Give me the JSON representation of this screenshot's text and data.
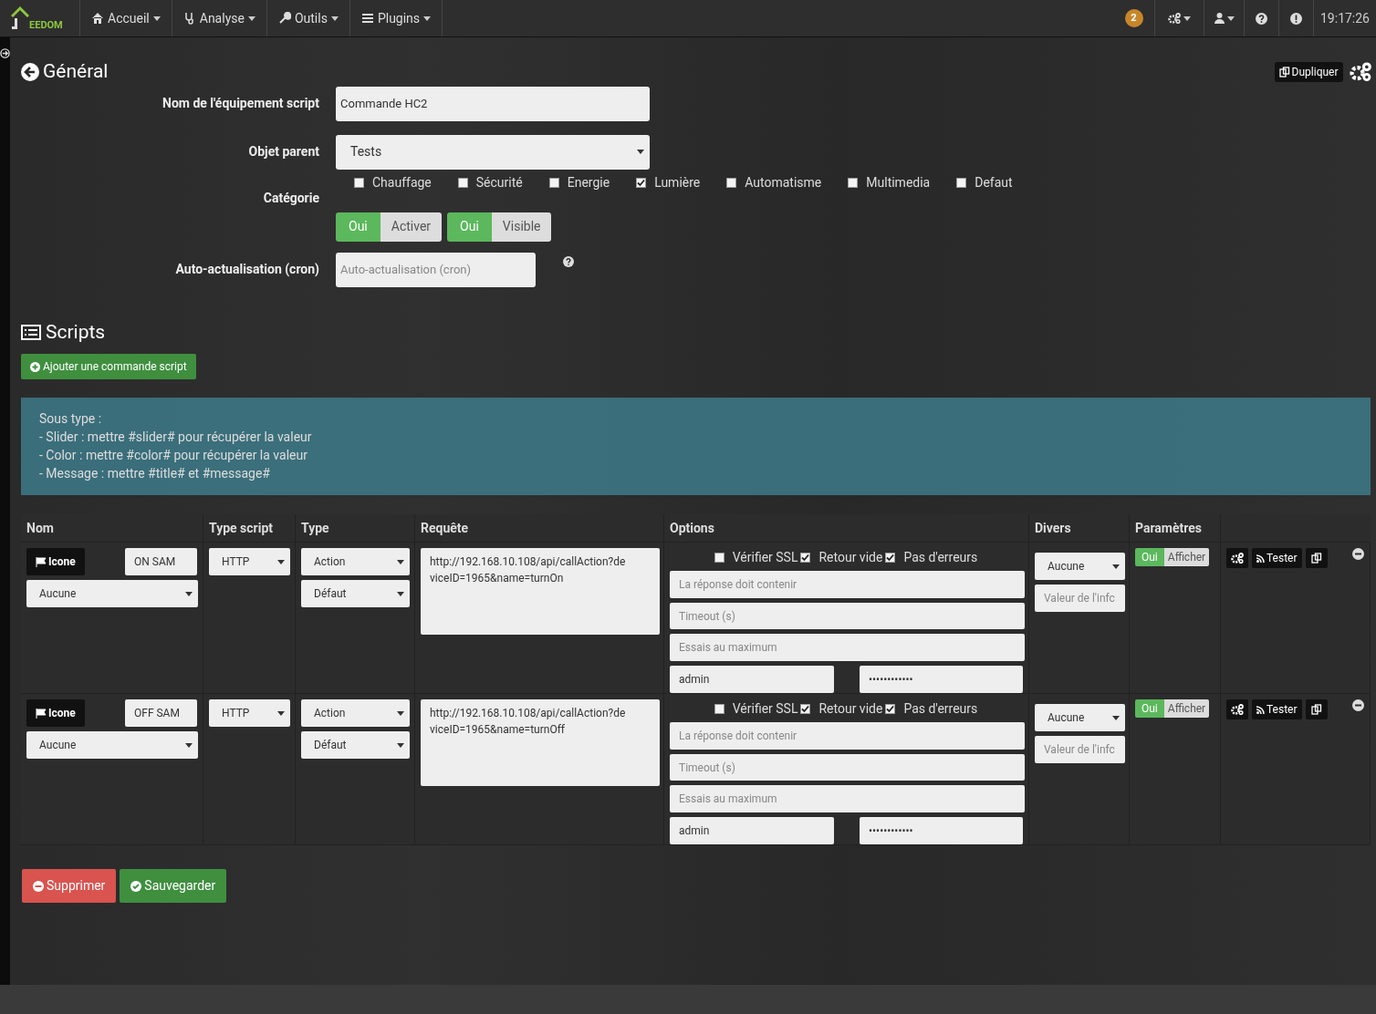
{
  "navbar": {
    "logo_text": "EEDOM",
    "menu": [
      {
        "label": "Accueil"
      },
      {
        "label": "Analyse"
      },
      {
        "label": "Outils"
      },
      {
        "label": "Plugins"
      }
    ],
    "badge": "2",
    "time": "19:17:26"
  },
  "general": {
    "title": "Général",
    "duplicate_button": "Dupliquer",
    "fields": [
      {
        "label": "Nom de l'équipement script",
        "kind": "text",
        "value": "Commande HC2"
      },
      {
        "label": "Objet parent",
        "kind": "select",
        "value": "Tests"
      }
    ],
    "category_label": "Catégorie",
    "categories": [
      {
        "label": "Chauffage",
        "checked": false
      },
      {
        "label": "Sécurité",
        "checked": false
      },
      {
        "label": "Energie",
        "checked": false
      },
      {
        "label": "Lumière",
        "checked": true
      },
      {
        "label": "Automatisme",
        "checked": false
      },
      {
        "label": "Multimedia",
        "checked": false
      },
      {
        "label": "Defaut",
        "checked": false
      }
    ],
    "toggles": [
      {
        "state": "Oui",
        "label": "Activer",
        "on": true
      },
      {
        "state": "Oui",
        "label": "Visible",
        "on": true
      }
    ],
    "cron": {
      "label": "Auto-actualisation (cron)",
      "placeholder": "Auto-actualisation (cron)"
    }
  },
  "scripts": {
    "title": "Scripts",
    "add_button": "Ajouter une commande script",
    "info": [
      "Sous type :",
      "- Slider : mettre #slider# pour récupérer la valeur",
      "- Color : mettre #color# pour récupérer la valeur",
      "- Message : mettre #title# et #message#"
    ],
    "columns": [
      "Nom",
      "Type script",
      "Type",
      "Requête",
      "Options",
      "Divers",
      "Paramètres"
    ],
    "rows": [
      {
        "icon_button": "Icone",
        "name": "ON SAM",
        "select": "Aucune",
        "type_script": "HTTP",
        "type": "Action",
        "subtype": "Défaut",
        "request": "http://192.168.10.108/api/callAction?deviceID=1965&name=turnOn",
        "options": [
          {
            "label": "Vérifier SSL",
            "checked": false
          },
          {
            "label": "Retour vide",
            "checked": true
          },
          {
            "label": "Pas d'erreurs",
            "checked": true
          }
        ],
        "placeholders": [
          "La réponse doit contenir",
          "Timeout (s)",
          "Essais au maximum"
        ],
        "user": "admin",
        "password": "••••••••••••",
        "divers_select": "Aucune",
        "divers_placeholder": "Valeur de l'infc",
        "show_state": "Oui",
        "show_on": true,
        "show_label": "Afficher",
        "test_button": "Tester"
      },
      {
        "icon_button": "Icone",
        "name": "OFF SAM",
        "select": "Aucune",
        "type_script": "HTTP",
        "type": "Action",
        "subtype": "Défaut",
        "request": "http://192.168.10.108/api/callAction?deviceID=1965&name=turnOff",
        "options": [
          {
            "label": "Vérifier SSL",
            "checked": false
          },
          {
            "label": "Retour vide",
            "checked": true
          },
          {
            "label": "Pas d'erreurs",
            "checked": true
          }
        ],
        "placeholders": [
          "La réponse doit contenir",
          "Timeout (s)",
          "Essais au maximum"
        ],
        "user": "admin",
        "password": "••••••••••••",
        "divers_select": "Aucune",
        "divers_placeholder": "Valeur de l'infc",
        "show_state": "Oui",
        "show_on": true,
        "show_label": "Afficher",
        "test_button": "Tester"
      }
    ]
  },
  "actions": [
    {
      "label": "Supprimer",
      "kind": "danger"
    },
    {
      "label": "Sauvegarder",
      "kind": "success"
    }
  ]
}
